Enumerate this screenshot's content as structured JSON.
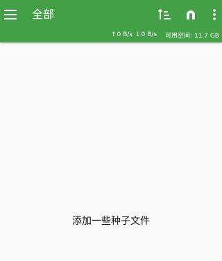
{
  "toolbar": {
    "title": "全部",
    "menu_icon": "menu-icon",
    "sort_icon": "sort-icon",
    "magnet_icon": "magnet-icon",
    "more_icon": "more-vert-icon",
    "color": "#43a047"
  },
  "status": {
    "upload_arrow": "↑",
    "upload_speed": "0 B/s",
    "download_arrow": "↓",
    "download_speed": "0 B/s",
    "available_space_label": "可用空间:",
    "available_space_value": "11.7 GB"
  },
  "main": {
    "empty_message": "添加一些种子文件"
  }
}
